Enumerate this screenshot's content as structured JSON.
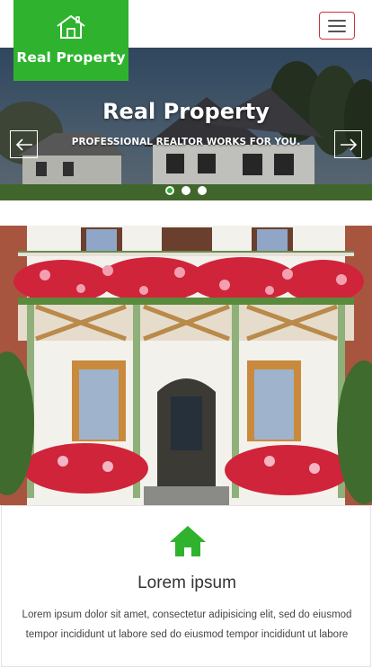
{
  "brand": {
    "name": "Real Property",
    "logo_icon": "house-outline-icon",
    "accent_color": "#2fb32f"
  },
  "nav": {
    "menu_icon": "hamburger-menu-icon",
    "menu_border_color": "#c9373a"
  },
  "hero": {
    "title": "Real Property",
    "subtitle": "PROFESSIONAL REALTOR WORKS FOR YOU.",
    "prev_icon": "arrow-left-icon",
    "next_icon": "arrow-right-icon",
    "slide_count": 3,
    "active_slide": 1
  },
  "feature": {
    "image": "house-balcony-flowers-photo",
    "icon": "home-icon",
    "title": "Lorem ipsum",
    "text": "Lorem ipsum dolor sit amet, consectetur adipisicing elit, sed do eiusmod tempor incididunt ut labore sed do eiusmod tempor incididunt ut labore"
  }
}
